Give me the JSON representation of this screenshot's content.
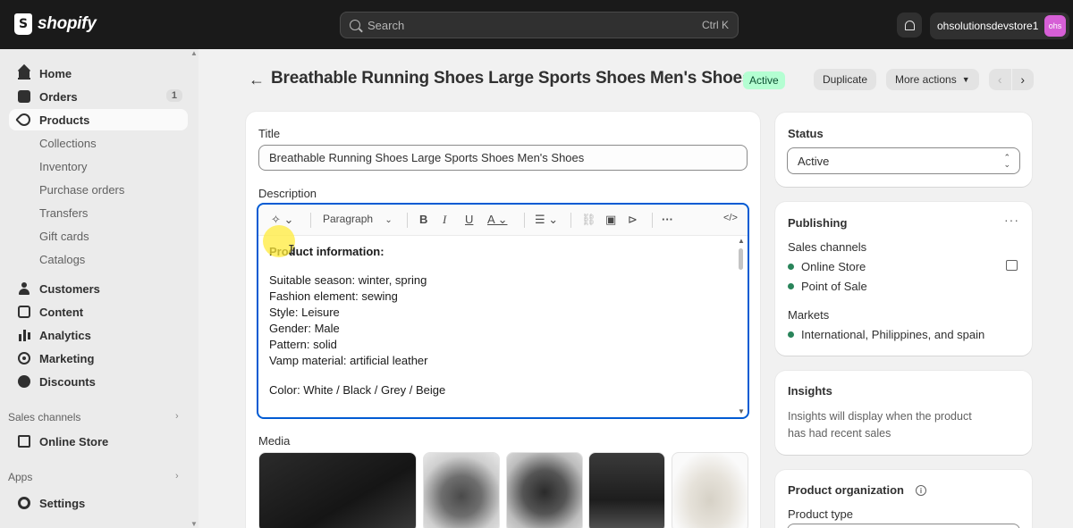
{
  "topbar": {
    "brand": "shopify",
    "search_placeholder": "Search",
    "search_shortcut": "Ctrl K",
    "store_name": "ohsolutionsdevstore1",
    "store_avatar": "ohs"
  },
  "sidebar": {
    "items": [
      {
        "label": "Home",
        "icon": "home-icon"
      },
      {
        "label": "Orders",
        "icon": "orders-icon",
        "badge": "1"
      },
      {
        "label": "Products",
        "icon": "tag-icon"
      },
      {
        "label": "Collections"
      },
      {
        "label": "Inventory"
      },
      {
        "label": "Purchase orders"
      },
      {
        "label": "Transfers"
      },
      {
        "label": "Gift cards"
      },
      {
        "label": "Catalogs"
      },
      {
        "label": "Customers",
        "icon": "person-icon"
      },
      {
        "label": "Content",
        "icon": "content-icon"
      },
      {
        "label": "Analytics",
        "icon": "analytics-icon"
      },
      {
        "label": "Marketing",
        "icon": "marketing-icon"
      },
      {
        "label": "Discounts",
        "icon": "discount-icon"
      },
      {
        "label": "Online Store",
        "icon": "store-icon"
      },
      {
        "label": "Settings",
        "icon": "settings-icon"
      }
    ],
    "sales_channels_label": "Sales channels",
    "apps_label": "Apps"
  },
  "header": {
    "title": "Breathable Running Shoes Large Sports Shoes Men's Shoes",
    "status": "Active",
    "duplicate": "Duplicate",
    "more_actions": "More actions"
  },
  "product": {
    "title_label": "Title",
    "title_value": "Breathable Running Shoes Large Sports Shoes Men's Shoes",
    "description_label": "Description",
    "toolbar": {
      "paragraph": "Paragraph"
    },
    "description": {
      "heading": "Product information:",
      "lines": [
        "Suitable season: winter, spring",
        "Fashion element: sewing",
        "Style: Leisure",
        "Gender: Male",
        "Pattern: solid",
        "Vamp material: artificial leather"
      ],
      "color_line": "Color: White / Black / Grey / Beige"
    },
    "media_label": "Media"
  },
  "status_card": {
    "title": "Status",
    "value": "Active"
  },
  "publishing": {
    "title": "Publishing",
    "sales_channels_label": "Sales channels",
    "channels": [
      "Online Store",
      "Point of Sale"
    ],
    "markets_label": "Markets",
    "markets": "International, Philippines, and spain"
  },
  "insights": {
    "title": "Insights",
    "text_line1": "Insights will display when the product",
    "text_line2": "has had recent sales"
  },
  "organization": {
    "title": "Product organization",
    "type_label": "Product type"
  },
  "colors": {
    "accent": "#005bd3",
    "active_bg": "#b4fed2",
    "active_text": "#0c5132",
    "channel_dot": "#29845a",
    "topbar": "#1a1a1a"
  }
}
